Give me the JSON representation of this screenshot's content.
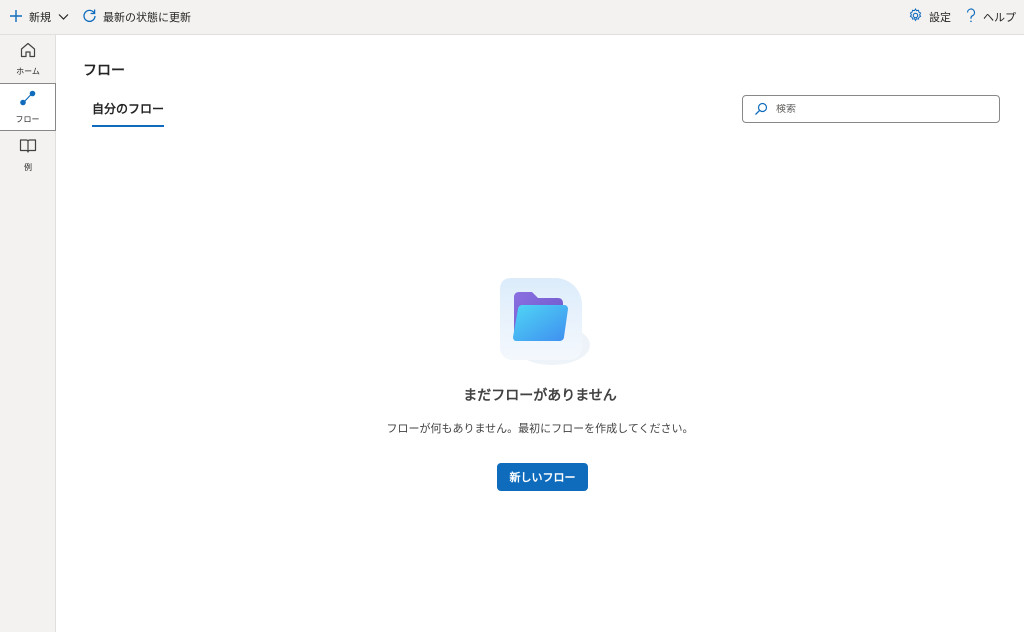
{
  "toolbar": {
    "new_label": "新規",
    "refresh_label": "最新の状態に更新",
    "settings_label": "設定",
    "help_label": "ヘルプ"
  },
  "sidebar": {
    "items": [
      {
        "label": "ホーム",
        "icon": "home-icon",
        "active": false
      },
      {
        "label": "フロー",
        "icon": "flow-icon",
        "active": true
      },
      {
        "label": "例",
        "icon": "book-icon",
        "active": false
      }
    ]
  },
  "main": {
    "title": "フロー",
    "tabs": [
      {
        "label": "自分のフロー",
        "active": true
      }
    ],
    "search": {
      "placeholder": "検索",
      "value": ""
    },
    "empty_state": {
      "icon": "folder-icon",
      "title": "まだフローがありません",
      "description": "フローが何もありません。最初にフローを作成してください。",
      "button_label": "新しいフロー"
    }
  },
  "colors": {
    "accent": "#0f6cbd",
    "chrome_bg": "#f3f2f1",
    "border": "#e1dfdd"
  }
}
